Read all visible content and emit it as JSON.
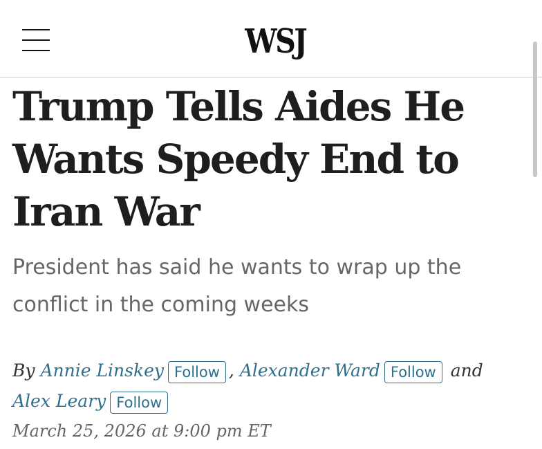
{
  "header": {
    "logo": "WSJ"
  },
  "article": {
    "headline": "Trump Tells Aides He Wants Speedy End to Iran War",
    "dek": "President has said he wants to wrap up the conflict in the coming weeks",
    "byline": {
      "prefix": "By",
      "separator": ",",
      "conjunction": "and",
      "follow_label": "Follow",
      "authors": [
        {
          "name": "Annie Linskey"
        },
        {
          "name": "Alexander Ward"
        },
        {
          "name": "Alex Leary"
        }
      ]
    },
    "date": "March 25, 2026 at 9:00 pm ET"
  },
  "colors": {
    "accent": "#2f6f8e",
    "headline": "#1e1e1e",
    "dek": "#666666",
    "divider": "#cfcfcf"
  }
}
